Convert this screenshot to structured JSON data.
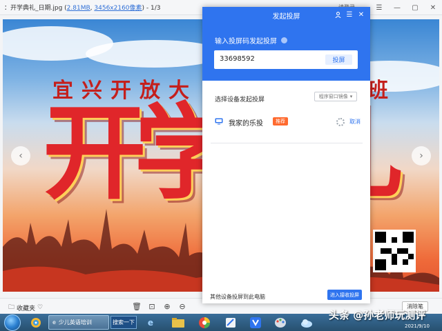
{
  "viewer": {
    "file_name": "：开学典礼_日期.jpg",
    "file_size": "2.81MB",
    "dimensions": "3456x2160像素",
    "image_index": "1/3",
    "user_label": "请登录",
    "favorite_label": "收藏夹",
    "clear_label": "消除笔"
  },
  "poster": {
    "headline": "宜兴开放大",
    "headline_tail": "班",
    "big_chars": [
      "开",
      "学",
      "礼"
    ]
  },
  "dialog": {
    "title": "发起投屏",
    "prompt": "输入投屏码发起投屏",
    "code_value": "33698592",
    "cast_button": "投屏",
    "device_section_label": "选择设备发起投屏",
    "mode_select_value": "程序窗口镜像",
    "device": {
      "name": "我家的乐投",
      "badge": "推荐",
      "cancel_label": "取消"
    },
    "footer_label": "其他设备投屏到此电脑",
    "receive_button": "进入接收投屏"
  },
  "taskbar": {
    "browser_window_title": "少儿英语培训",
    "search_button": "搜索一下",
    "date": "2021/9/10"
  },
  "watermark": "头条 @孙老师玩测评",
  "colors": {
    "accent": "#2f74ef",
    "badge": "#ff6a2f",
    "poster_red": "#e0262a"
  }
}
